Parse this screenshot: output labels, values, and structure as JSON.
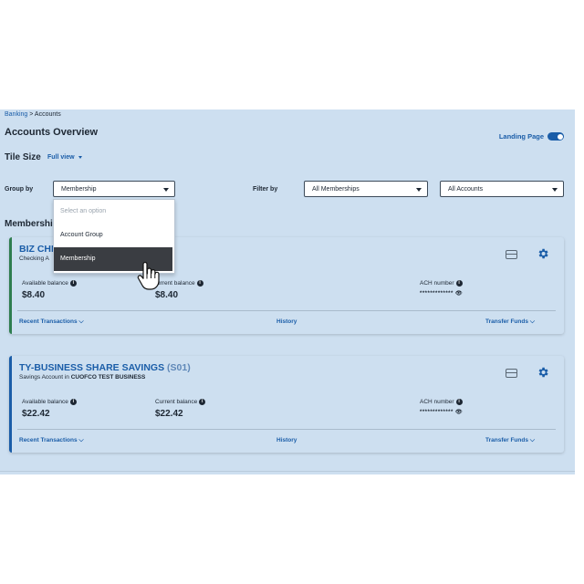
{
  "breadcrumb": {
    "root": "Banking",
    "sep": ">",
    "current": "Accounts"
  },
  "page_title": "Accounts Overview",
  "landing_page_label": "Landing Page",
  "tile_size": {
    "label": "Tile Size",
    "value": "Full view"
  },
  "group_by": {
    "label": "Group by",
    "value": "Membership",
    "options": [
      "Select an option",
      "Account Group",
      "Membership"
    ]
  },
  "filter_by": {
    "label": "Filter by",
    "membership_value": "All Memberships",
    "accounts_value": "All Accounts"
  },
  "section_title": "Membership",
  "accounts": [
    {
      "name": "BIZ CHE",
      "subtitle": "Checking A",
      "available_label": "Available balance",
      "available_value": "$8.40",
      "current_label": "urrent balance",
      "current_value": "$8.40",
      "ach_label": "ACH number",
      "ach_value": "*************",
      "recent_label": "Recent Transactions",
      "history_label": "History",
      "transfer_label": "Transfer Funds",
      "accent": "#2e7d4f"
    },
    {
      "name": "TY-BUSINESS SHARE SAVINGS",
      "id": "(S01)",
      "subtitle_prefix": "Savings Account in ",
      "subtitle_strong": "CUOFCO TEST BUSINESS",
      "available_label": "Available balance",
      "available_value": "$22.42",
      "current_label": "Current balance",
      "current_value": "$22.42",
      "ach_label": "ACH number",
      "ach_value": "*************",
      "recent_label": "Recent Transactions",
      "history_label": "History",
      "transfer_label": "Transfer Funds",
      "accent": "#1a5da8"
    }
  ],
  "colors": {
    "brand": "#1a5da8",
    "panel_bg": "#cddff0",
    "menu_hover": "#3a3d42"
  }
}
